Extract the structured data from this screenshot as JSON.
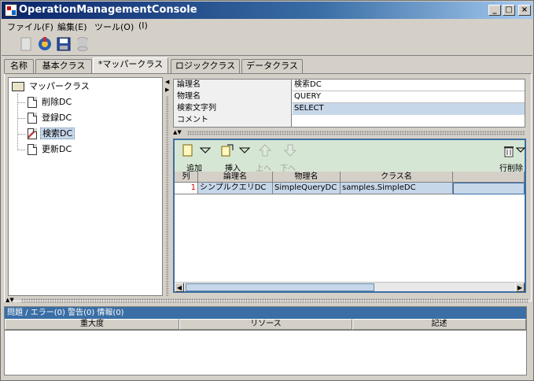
{
  "window": {
    "title": "OperationManagementConsole"
  },
  "menu": [
    "ファイル(F)",
    "編集(E)",
    "ツール(O)",
    "(I)"
  ],
  "tabs": [
    "名称",
    "基本クラス",
    "*マッパークラス",
    "ロジッククラス",
    "データクラス"
  ],
  "active_tab": 2,
  "tree": {
    "root": "マッパークラス",
    "items": [
      "削除DC",
      "登録DC",
      "検索DC",
      "更新DC"
    ],
    "selected": 2
  },
  "properties": [
    {
      "key": "論理名",
      "value": "検索DC"
    },
    {
      "key": "物理名",
      "value": "QUERY"
    },
    {
      "key": "検索文字列",
      "value": "SELECT"
    },
    {
      "key": "コメント",
      "value": ""
    }
  ],
  "column_toolbar": {
    "add": "追加",
    "insert": "挿入",
    "up": "上へ",
    "down": "下へ",
    "delete_row": "行削除"
  },
  "grid": {
    "headers": [
      "列",
      "論理名",
      "物理名",
      "クラス名",
      ""
    ],
    "rows": [
      {
        "num": "1",
        "logical": "シンプルクエリDC",
        "physical": "SimpleQueryDC",
        "class": "samples.SimpleDC",
        "extra": ""
      }
    ]
  },
  "problems": {
    "title": "問題 / エラー(0) 警告(0) 情報(0)",
    "headers": [
      "重大度",
      "リソース",
      "記述"
    ]
  },
  "colors": {
    "selection": "#c7d7ea",
    "accent": "#3a6ea5",
    "toolbar_green": "#d6e6d4"
  }
}
